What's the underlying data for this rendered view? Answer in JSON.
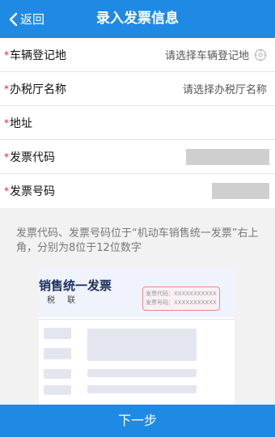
{
  "header": {
    "back_label": "返回",
    "title": "录入发票信息"
  },
  "form": {
    "required_mark": "*",
    "rows": [
      {
        "label": "车辆登记地",
        "placeholder": "请选择车辆登记地",
        "icon": "location-icon"
      },
      {
        "label": "办税厅名称",
        "placeholder": "请选择办税厅名称"
      },
      {
        "label": "地址"
      },
      {
        "label": "发票代码"
      },
      {
        "label": "发票号码"
      }
    ]
  },
  "hint": {
    "text": "发票代码、发票号码位于“机动车销售统一发票”右上角，分别为8位于12位数字"
  },
  "sample_invoice": {
    "title": "销售统一发票",
    "subtitle": "税 联",
    "code_line": "发票代码：XXXXXXXXXXX",
    "number_line": "发票号码：XXXXXXXXXXX"
  },
  "footer": {
    "next_label": "下一步"
  },
  "colors": {
    "primary": "#1f8ae4",
    "required": "#e02020",
    "highlight_box": "#e68a8a"
  }
}
